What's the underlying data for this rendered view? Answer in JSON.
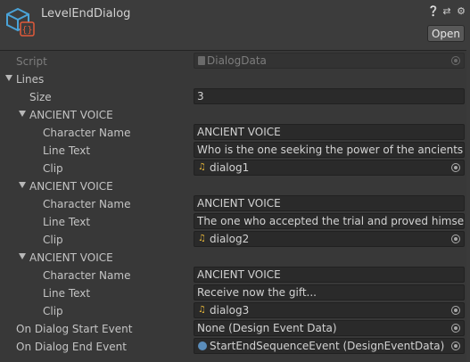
{
  "header": {
    "title": "LevelEndDialog",
    "open_label": "Open",
    "icons": [
      "help-icon",
      "preset-icon",
      "gear-icon"
    ]
  },
  "script_field": {
    "label": "Script",
    "value": "DialogData"
  },
  "lines": {
    "label": "Lines",
    "size_label": "Size",
    "size_value": "3",
    "items": [
      {
        "header": "ANCIENT VOICE",
        "character_name_label": "Character Name",
        "character_name": "ANCIENT VOICE",
        "line_text_label": "Line Text",
        "line_text": "Who is the one seeking the power of the ancients?",
        "clip_label": "Clip",
        "clip": "dialog1"
      },
      {
        "header": "ANCIENT VOICE",
        "character_name_label": "Character Name",
        "character_name": "ANCIENT VOICE",
        "line_text_label": "Line Text",
        "line_text": "The one who accepted the trial and proved himself wo",
        "clip_label": "Clip",
        "clip": "dialog2"
      },
      {
        "header": "ANCIENT VOICE",
        "character_name_label": "Character Name",
        "character_name": "ANCIENT VOICE",
        "line_text_label": "Line Text",
        "line_text": "Receive now the gift...",
        "clip_label": "Clip",
        "clip": "dialog3"
      }
    ]
  },
  "events": {
    "start_label": "On Dialog Start Event",
    "start_value": "None (Design Event Data)",
    "end_label": "On Dialog End Event",
    "end_value": "StartEndSequenceEvent (DesignEventData)"
  }
}
